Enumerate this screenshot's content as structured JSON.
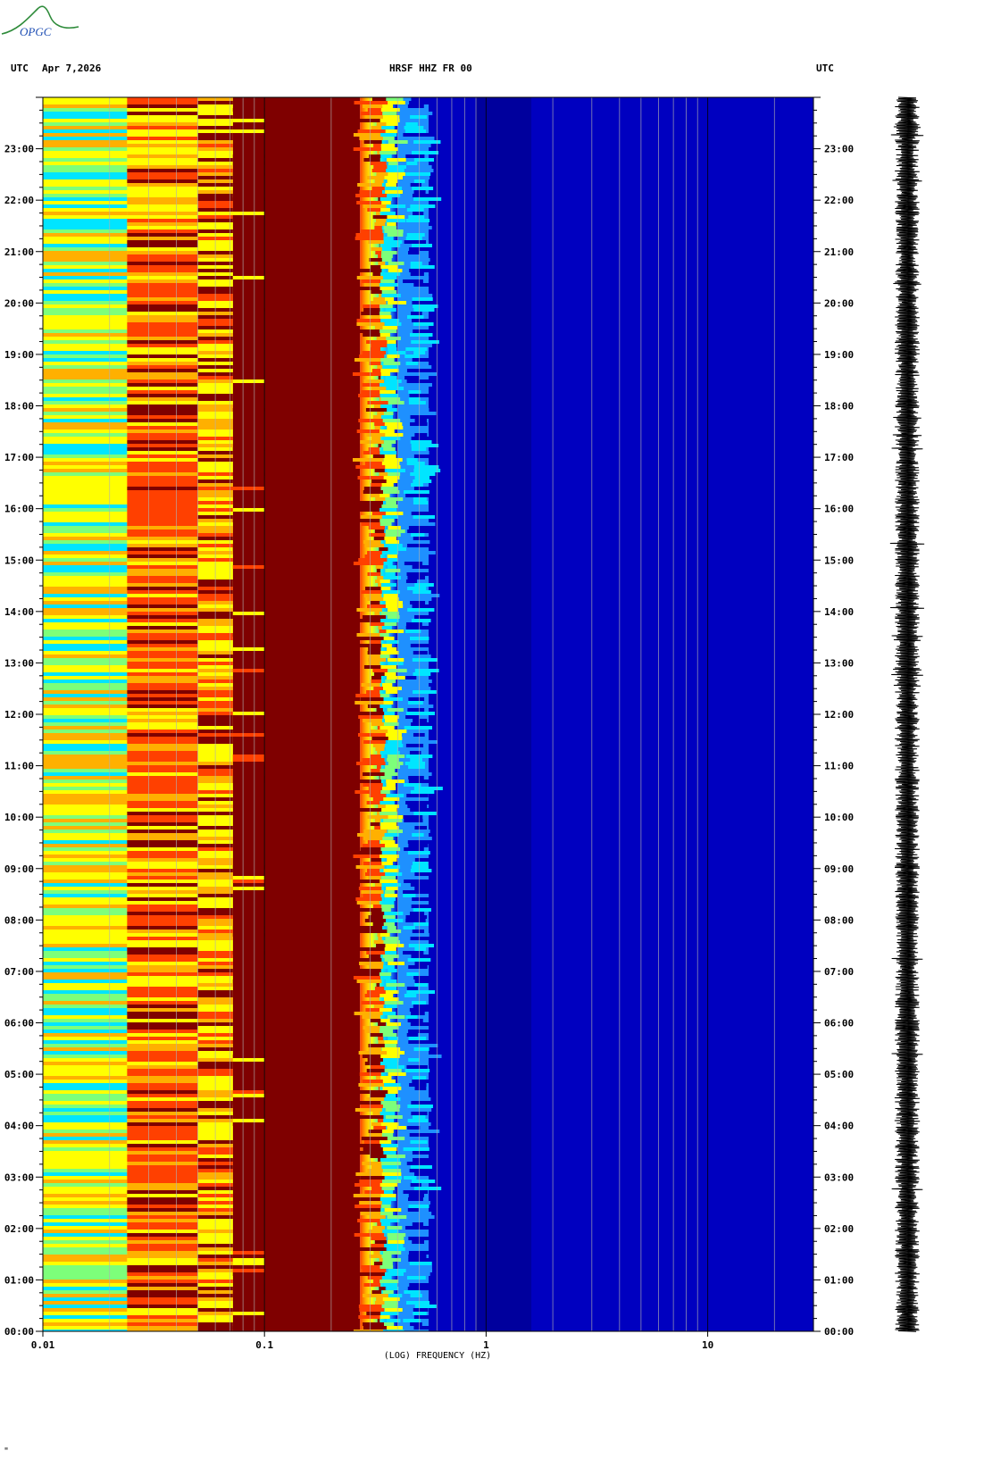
{
  "header": {
    "tz_left": "UTC",
    "date": "Apr 7,2026",
    "station": "HRSF HHZ FR 00",
    "tz_right": "UTC"
  },
  "logo": {
    "text": "OPGC",
    "color": "#2e8b3a"
  },
  "footer": {
    "mark": "\""
  },
  "chart_data": {
    "type": "heatmap",
    "xlabel": "(LOG) FREQUENCY (HZ)",
    "x_scale": "log",
    "xlim": [
      0.01,
      30
    ],
    "x_ticks": [
      {
        "value": 0.01,
        "label": "0.01"
      },
      {
        "value": 0.1,
        "label": "0.1"
      },
      {
        "value": 1,
        "label": "1"
      },
      {
        "value": 10,
        "label": "10"
      }
    ],
    "ylim_hours": [
      0,
      24
    ],
    "y_ticks": [
      "00:00",
      "01:00",
      "02:00",
      "03:00",
      "04:00",
      "05:00",
      "06:00",
      "07:00",
      "08:00",
      "09:00",
      "10:00",
      "11:00",
      "12:00",
      "13:00",
      "14:00",
      "15:00",
      "16:00",
      "17:00",
      "18:00",
      "19:00",
      "20:00",
      "21:00",
      "22:00",
      "23:00"
    ],
    "grid": true,
    "colormap": [
      "#00007f",
      "#0000c0",
      "#1e90ff",
      "#00e5ff",
      "#7dff7a",
      "#ffff00",
      "#ffb000",
      "#ff4000",
      "#7f0000"
    ],
    "spectral_bands": [
      {
        "f_min": 0.01,
        "f_max": 0.024,
        "level": "yellow-green"
      },
      {
        "f_min": 0.024,
        "f_max": 0.05,
        "level": "orange-red"
      },
      {
        "f_min": 0.05,
        "f_max": 0.072,
        "level": "yellow-red"
      },
      {
        "f_min": 0.072,
        "f_max": 0.1,
        "level": "dark-red"
      },
      {
        "f_min": 0.1,
        "f_max": 0.27,
        "level": "dark-red"
      },
      {
        "f_min": 0.27,
        "f_max": 0.4,
        "level": "red-to-cyan"
      },
      {
        "f_min": 0.4,
        "f_max": 0.55,
        "level": "cyan-blue"
      },
      {
        "f_min": 0.55,
        "f_max": 30,
        "level": "deep-blue"
      }
    ],
    "trace": {
      "label": "seismogram",
      "color": "#000000"
    }
  }
}
